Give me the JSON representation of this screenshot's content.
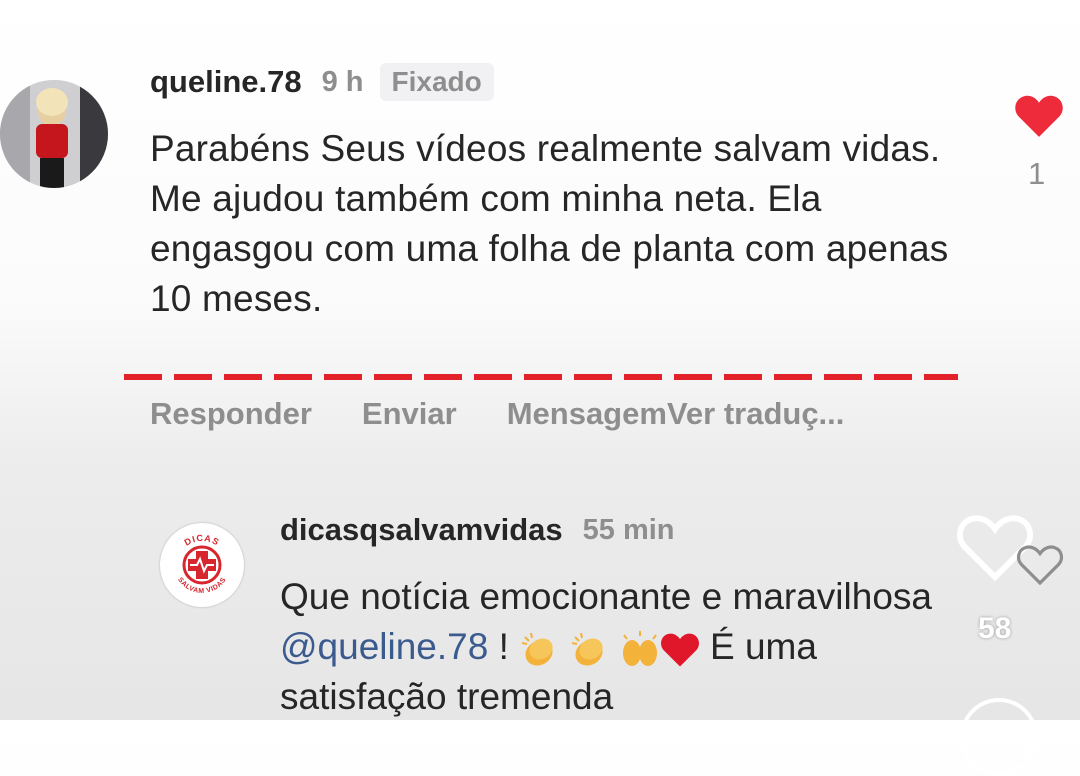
{
  "comment": {
    "username": "queline.78",
    "time": "9 h",
    "pinned_label": "Fixado",
    "text_line1": "Parabéns Seus vídeos realmente salvam vidas.",
    "text_line2": "Me ajudou também com minha neta. Ela engasgou com uma folha de planta com apenas 10 meses.",
    "like_count": "1",
    "actions": {
      "reply": "Responder",
      "send": "Enviar",
      "message": "Mensagem",
      "translate": "Ver traduç..."
    }
  },
  "reply": {
    "username": "dicasqsalvamvidas",
    "time": "55 min",
    "text_part1": "Que notícia emocionante e maravilhosa ",
    "mention": "@queline.78",
    "text_part2": " !",
    "text_part3": " É uma satisfação tremenda",
    "avatar_top_text": "DICAS",
    "avatar_bottom_text": "SALVAM VIDAS"
  },
  "overlay": {
    "like_count": "58"
  },
  "colors": {
    "liked_heart": "#ed2b3b",
    "underline": "#e3212b",
    "mention": "#3b5b8f",
    "muted_text": "#8e8e8e"
  },
  "icons": {
    "like": "heart-filled-icon",
    "reply_like": "heart-outline-icon",
    "overlay_like": "heart-outline-icon",
    "clap": "clapping-hands-emoji",
    "raised_hands": "raised-hands-emoji",
    "red_heart": "red-heart-emoji"
  }
}
